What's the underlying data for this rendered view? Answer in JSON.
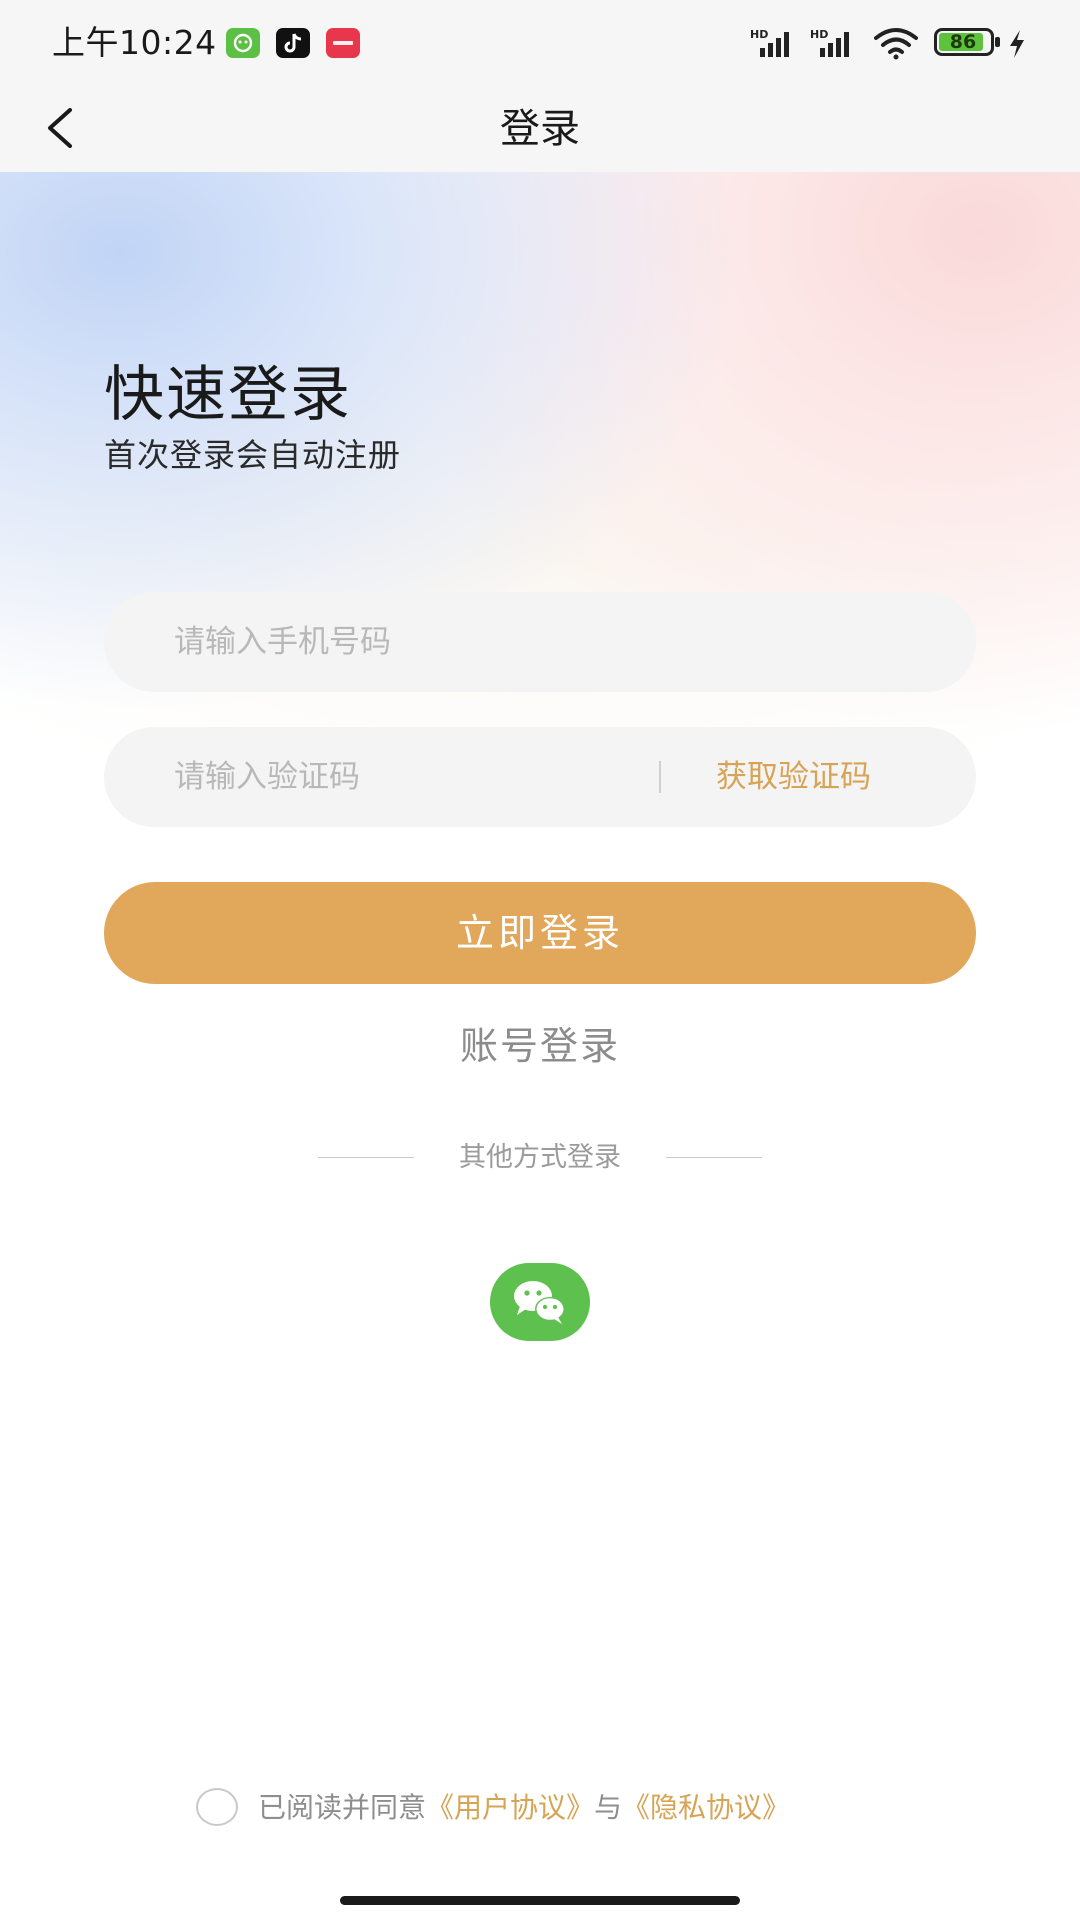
{
  "status_bar": {
    "time": "上午10:24",
    "battery_level": "86",
    "network_1": "HD",
    "network_2": "HD"
  },
  "nav": {
    "title": "登录"
  },
  "hero": {
    "title": "快速登录",
    "subtitle": "首次登录会自动注册"
  },
  "form": {
    "phone_placeholder": "请输入手机号码",
    "code_placeholder": "请输入验证码",
    "get_code_label": "获取验证码",
    "login_button": "立即登录",
    "account_login": "账号登录"
  },
  "other_methods": {
    "label": "其他方式登录",
    "icons": [
      "wechat-icon"
    ]
  },
  "agreement": {
    "prefix": "已阅读并同意",
    "user_agreement": "《用户协议》",
    "conjunction": "与",
    "privacy_agreement": "《隐私协议》"
  },
  "colors": {
    "accent": "#e1a75a",
    "link": "#d7a456",
    "wechat": "#5ec04e"
  }
}
